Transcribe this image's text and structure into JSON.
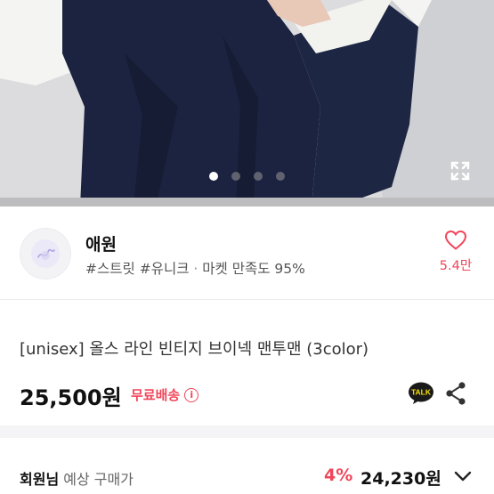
{
  "carousel": {
    "total": 4,
    "active_index": 0
  },
  "shop": {
    "name": "애원",
    "tags": "#스트릿 #유니크",
    "separator": "·",
    "satisfaction": "마켓 만족도 95%",
    "likes": "5.4만"
  },
  "product": {
    "title": "[unisex] 올스 라인 빈티지 브이넥 맨투맨 (3color)",
    "price": "25,500원",
    "shipping": "무료배송",
    "info_symbol": "i",
    "talk_label": "TALK"
  },
  "member": {
    "label_bold": "회원님",
    "label_rest": " 예상 구매가",
    "discount": "4%",
    "price": "24,230원"
  },
  "colors": {
    "accent": "#f0465a",
    "navy": "#1b2340",
    "kakao": "#f9e000"
  },
  "icons": {
    "expand": "expand-icon",
    "heart": "heart-icon",
    "info": "info-icon",
    "kakao": "kakao-talk-icon",
    "share": "share-icon",
    "chevron": "chevron-down-icon"
  }
}
